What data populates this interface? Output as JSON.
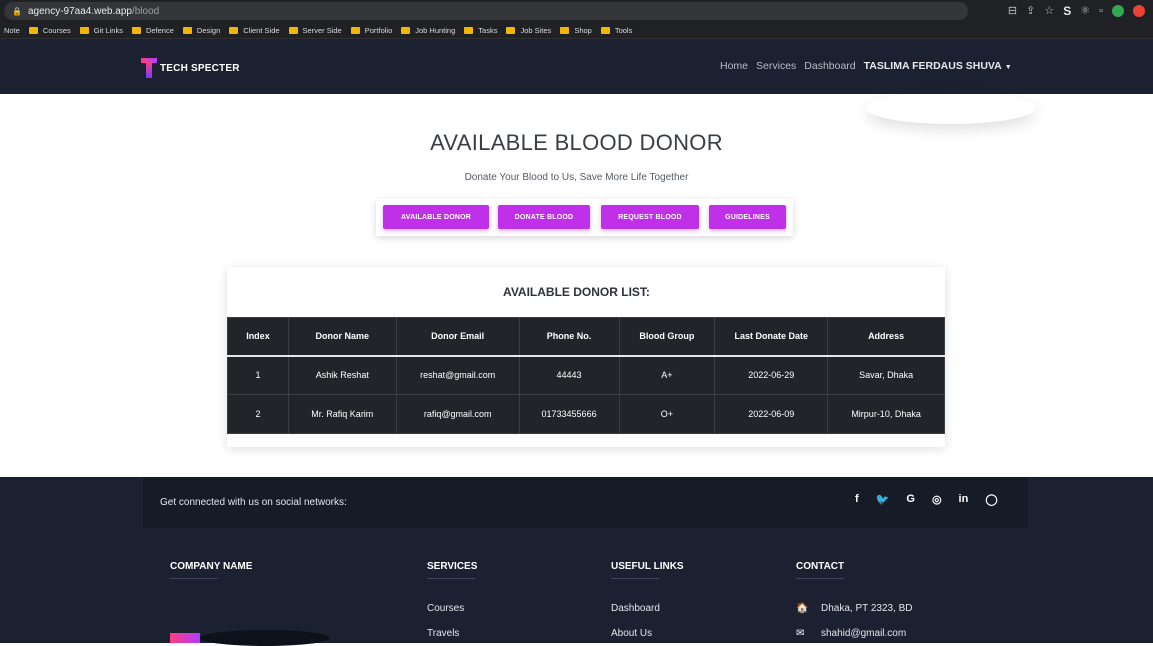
{
  "browser": {
    "url_host": "agency-97aa4.web.app",
    "url_path": "/blood",
    "bookmarks": [
      "Note",
      "Courses",
      "Git Links",
      "Defence",
      "Design",
      "Client Side",
      "Server Side",
      "Portfolio",
      "Job Hunting",
      "Tasks",
      "Job Sites",
      "Shop",
      "Tools"
    ]
  },
  "nav": {
    "logo_text": "TECH SPECTER",
    "home": "Home",
    "services": "Services",
    "dashboard": "Dashboard",
    "user": "TASLIMA FERDAUS SHUVA"
  },
  "hero": {
    "title": "AVAILABLE BLOOD DONOR",
    "subtitle": "Donate Your Blood to Us, Save More Life Together",
    "buttons": [
      "AVAILABLE DONOR",
      "DONATE BLOOD",
      "REQUEST BLOOD",
      "GUIDELINES"
    ]
  },
  "donor_list": {
    "title": "AVAILABLE DONOR LIST:",
    "headers": [
      "Index",
      "Donor Name",
      "Donor Email",
      "Phone No.",
      "Blood Group",
      "Last Donate Date",
      "Address"
    ],
    "rows": [
      [
        "1",
        "Ashik Reshat",
        "reshat@gmail.com",
        "44443",
        "A+",
        "2022-06-29",
        "Savar, Dhaka"
      ],
      [
        "2",
        "Mr. Rafiq Karim",
        "rafiq@gmail.com",
        "01733455666",
        "O+",
        "2022-06-09",
        "Mirpur-10, Dhaka"
      ]
    ]
  },
  "footer": {
    "social_text": "Get connected with us on social networks:",
    "social_icons": [
      "f",
      "🐦",
      "G",
      "◎",
      "in",
      "◯"
    ],
    "company_title": "COMPANY NAME",
    "services_title": "SERVICES",
    "services": [
      "Courses",
      "Travels"
    ],
    "useful_title": "USEFUL LINKS",
    "useful": [
      "Dashboard",
      "About Us"
    ],
    "contact_title": "CONTACT",
    "contact_address": "Dhaka, PT 2323, BD",
    "contact_email": "shahid@gmail.com"
  }
}
